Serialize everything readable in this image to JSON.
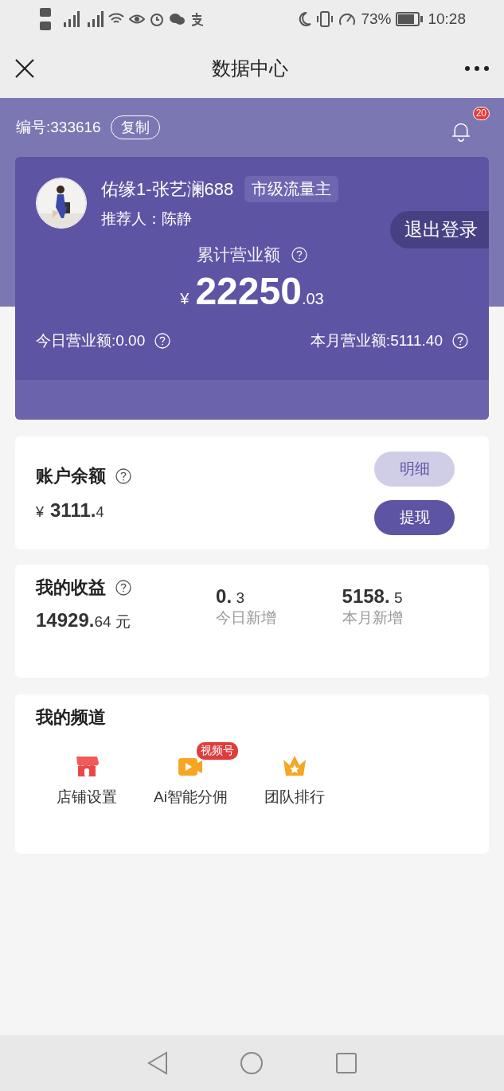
{
  "status_bar": {
    "battery": "73%",
    "time": "10:28"
  },
  "nav": {
    "title": "数据中心"
  },
  "header": {
    "id_label": "编号:333616",
    "copy_button": "复制",
    "notification_count": "20"
  },
  "profile": {
    "name": "佑缘1-张艺澜688",
    "level_badge": "市级流量主",
    "referrer": "推荐人：陈静",
    "logout_button": "退出登录"
  },
  "revenue": {
    "label": "累计营业额",
    "currency": "¥",
    "integer": "22250",
    "decimal": ".03",
    "today": "今日营业额:0.00",
    "month": "本月营业额:5111.40"
  },
  "balance": {
    "title": "账户余额",
    "currency": "¥",
    "integer": "3111.",
    "decimal": "4",
    "buttons": [
      {
        "label": "明细",
        "kind": "secondary"
      },
      {
        "label": "提现",
        "kind": "primary"
      }
    ]
  },
  "earnings": {
    "title": "我的收益",
    "total": {
      "integer": "14929.",
      "decimal": "64",
      "unit": "元"
    },
    "stats": [
      {
        "integer": "0.",
        "decimal": "3",
        "label": "今日新增"
      },
      {
        "integer": "5158.",
        "decimal": "5",
        "label": "本月新增"
      }
    ]
  },
  "channels": {
    "title": "我的频道",
    "items": [
      {
        "label": "店铺设置",
        "kind": "shop"
      },
      {
        "label": "Ai智能分佣",
        "kind": "video",
        "badge": "视频号"
      },
      {
        "label": "团队排行",
        "kind": "crown"
      }
    ]
  }
}
